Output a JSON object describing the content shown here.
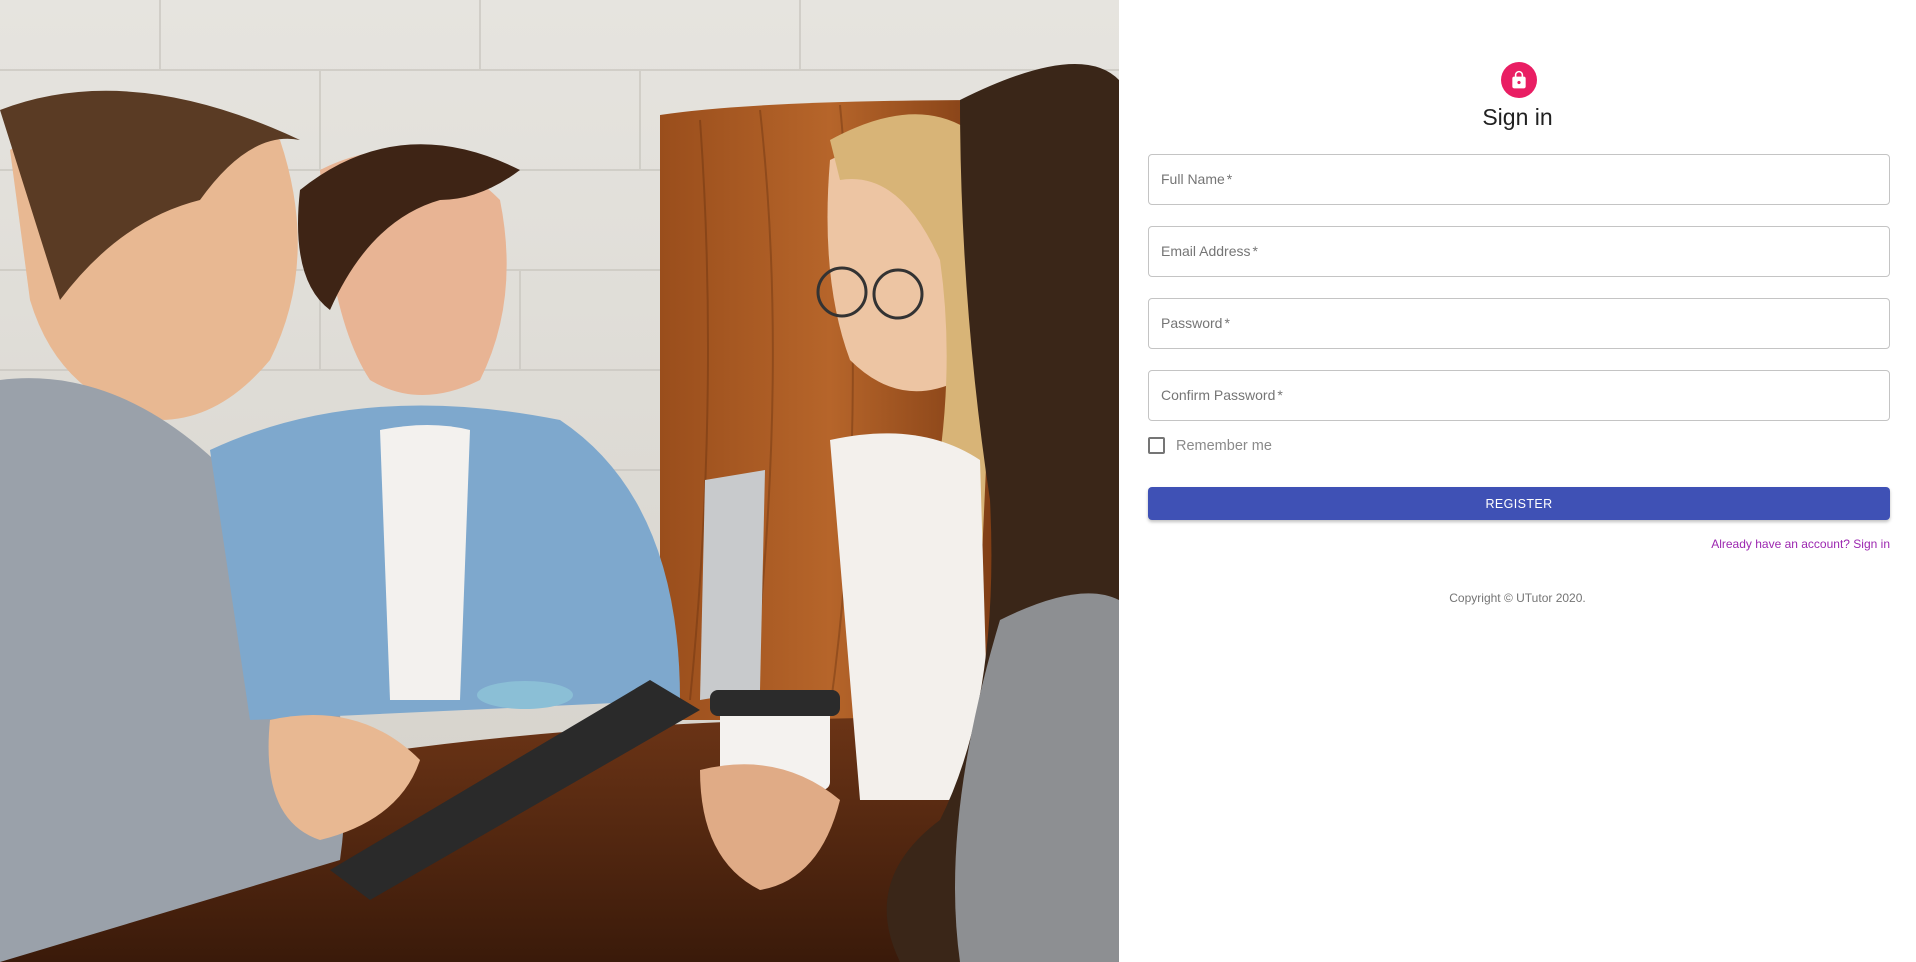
{
  "hero": {
    "image": "photo of four people smiling around a cafe table with coffee cups, a laptop and a tablet"
  },
  "form": {
    "icon": "lock-icon",
    "title": "Sign in",
    "fields": [
      {
        "label": "Full Name",
        "required_mark": "*",
        "value": ""
      },
      {
        "label": "Email Address",
        "required_mark": "*",
        "value": ""
      },
      {
        "label": "Password",
        "required_mark": "*",
        "value": ""
      },
      {
        "label": "Confirm Password",
        "required_mark": "*",
        "value": ""
      }
    ],
    "remember_label": "Remember me",
    "remember_checked": false,
    "submit_label": "REGISTER",
    "signin_link": "Already have an account? Sign in",
    "copyright": "Copyright © UTutor 2020."
  },
  "colors": {
    "accent": "#3f51b5",
    "avatar": "#e91e63",
    "link": "#9c27b0"
  }
}
